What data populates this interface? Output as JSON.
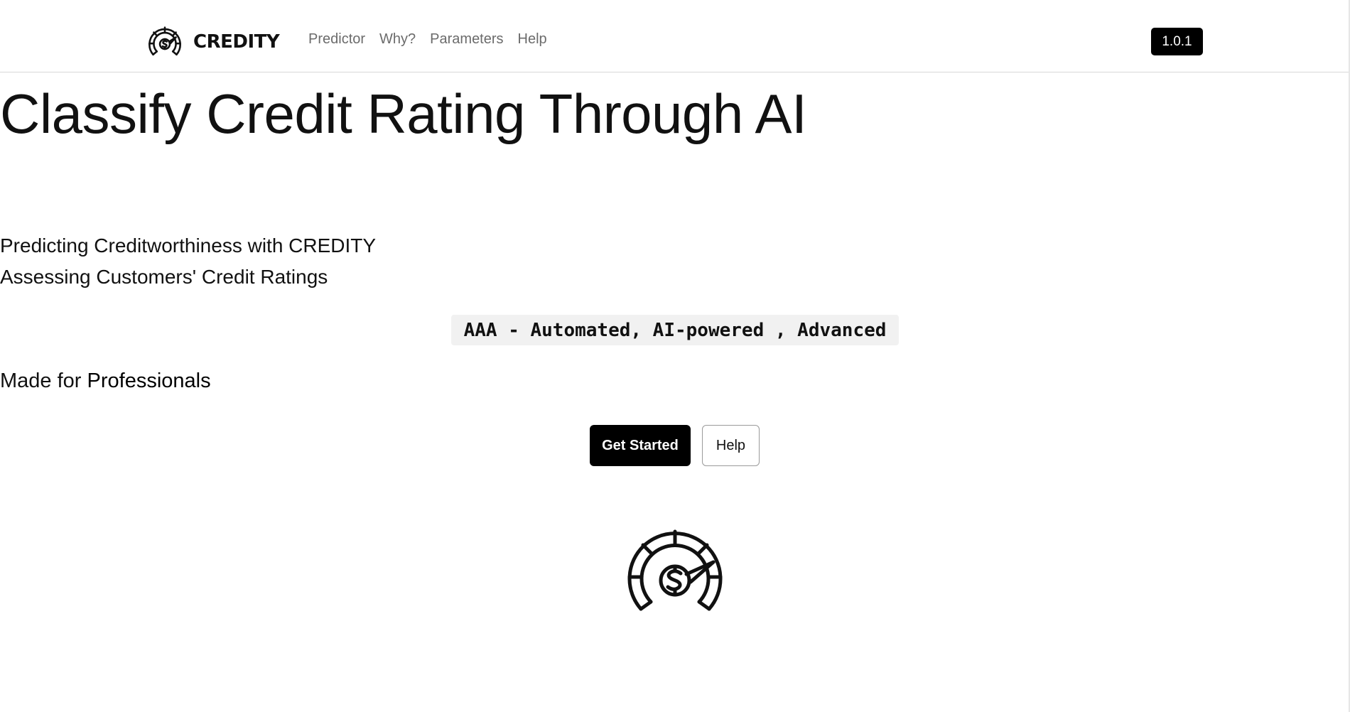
{
  "brand": {
    "name": "CREDITY",
    "logo_icon": "speedometer-dollar-icon"
  },
  "nav": {
    "items": [
      {
        "label": "Predictor"
      },
      {
        "label": "Why?"
      },
      {
        "label": "Parameters"
      },
      {
        "label": "Help"
      }
    ]
  },
  "version": "1.0.1",
  "hero": {
    "title": "Classify Credit Rating Through AI",
    "subtitle_line1": "Predicting Creditworthiness with CREDITY",
    "subtitle_line2": "Assessing Customers' Credit Ratings",
    "code_tag": "AAA - Automated, AI-powered , Advanced",
    "made_for_prefix": "Made for",
    "made_for_emphasis": "Professionals",
    "primary_button": "Get Started",
    "secondary_button": "Help",
    "illustration_icon": "speedometer-dollar-icon"
  },
  "colors": {
    "text": "#111111",
    "muted_nav": "#6b6b6b",
    "primary_bg": "#000000",
    "code_bg": "#f1f1f1",
    "divider": "#d9d9d9"
  }
}
